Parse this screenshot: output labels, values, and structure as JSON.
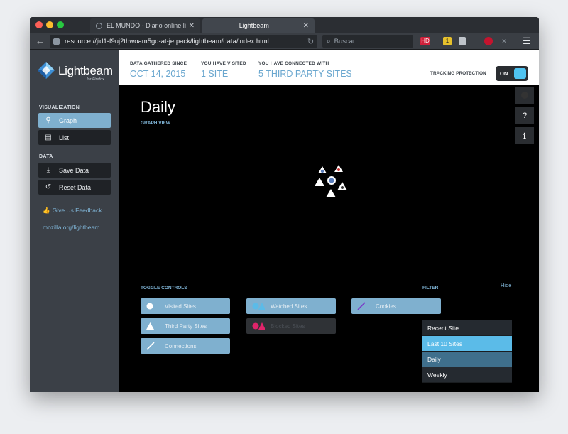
{
  "browser": {
    "tabs": [
      {
        "label": "EL MUNDO - Diario online lí..."
      },
      {
        "label": "Lightbeam"
      }
    ],
    "url": "resource://jid1-f9uj2thwoam5gq-at-jetpack/lightbeam/data/index.html",
    "search_placeholder": "Buscar",
    "extensions": {
      "hd": "HD",
      "badge": "1"
    }
  },
  "app": {
    "logo": "Lightbeam",
    "logo_sub": "for Firefox",
    "colors": {
      "accent": "#7fb0cf",
      "link": "#7fb4d6",
      "toggle_on": "#4fc3f0"
    }
  },
  "sidebar": {
    "visualization_label": "VISUALIZATION",
    "views": [
      {
        "label": "Graph",
        "icon": "graph-icon"
      },
      {
        "label": "List",
        "icon": "list-icon"
      }
    ],
    "data_label": "DATA",
    "actions": [
      {
        "label": "Save Data",
        "icon": "save-icon"
      },
      {
        "label": "Reset Data",
        "icon": "reset-icon"
      }
    ],
    "feedback": "Give Us Feedback",
    "site_link": "mozilla.org/lightbeam"
  },
  "header": {
    "stats": [
      {
        "label": "DATA GATHERED SINCE",
        "value": "OCT 14, 2015"
      },
      {
        "label": "YOU HAVE VISITED",
        "value": "1 SITE"
      },
      {
        "label": "YOU HAVE CONNECTED WITH",
        "value": "5 THIRD PARTY SITES"
      }
    ],
    "tracking_label": "TRACKING PROTECTION",
    "tracking_state": "ON"
  },
  "main": {
    "title": "Daily",
    "subtitle": "GRAPH VIEW",
    "toggle_label": "TOGGLE CONTROLS",
    "filter_label": "FILTER",
    "hide_label": "Hide",
    "toggles": [
      {
        "label": "Visited Sites",
        "state": "on"
      },
      {
        "label": "Third Party Sites",
        "state": "on"
      },
      {
        "label": "Connections",
        "state": "on"
      },
      {
        "label": "Watched Sites",
        "state": "on"
      },
      {
        "label": "Blocked Sites",
        "state": "off"
      },
      {
        "label": "Cookies",
        "state": "on"
      }
    ],
    "filters": [
      {
        "label": "Recent Site"
      },
      {
        "label": "Last 10 Sites"
      },
      {
        "label": "Daily"
      },
      {
        "label": "Weekly"
      }
    ]
  }
}
